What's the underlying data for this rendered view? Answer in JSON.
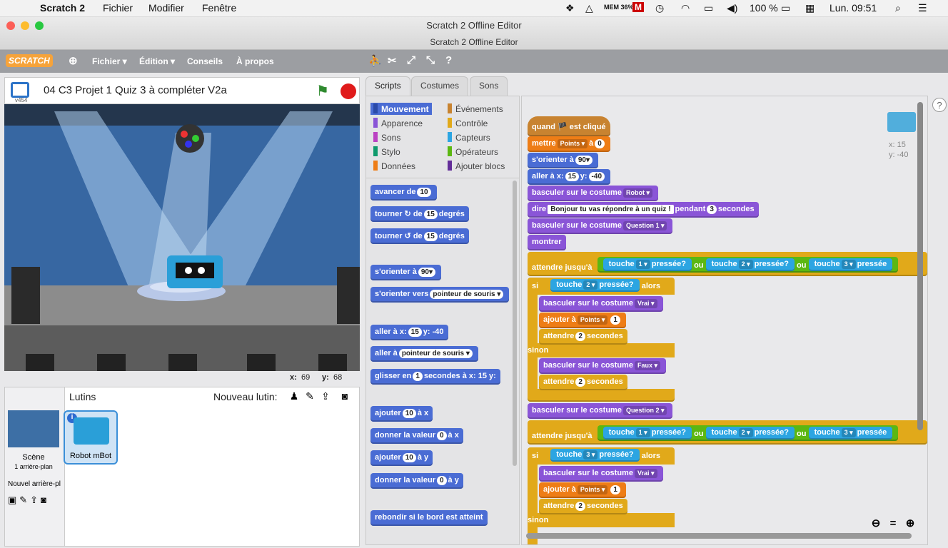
{
  "mac_menu": {
    "app": "Scratch 2",
    "items": [
      "Fichier",
      "Modifier",
      "Fenêtre"
    ],
    "mem": "MEM 36%",
    "battery": "100 %",
    "clock": "Lun. 09:51"
  },
  "window": {
    "title": "Scratch 2 Offline Editor",
    "subtitle": "Scratch 2 Offline Editor"
  },
  "scratch_menu": {
    "logo": "SCRATCH",
    "items": [
      "Fichier ▾",
      "Édition ▾",
      "Conseils",
      "À propos"
    ]
  },
  "stage": {
    "project_title": "04 C3 Projet 1 Quiz 3 à compléter V2a",
    "version": "v454",
    "mouse_x_label": "x:",
    "mouse_x": "69",
    "mouse_y_label": "y:",
    "mouse_y": "68"
  },
  "sprites_panel": {
    "title": "Lutins",
    "new_sprite": "Nouveau lutin:",
    "scene": "Scène",
    "scene_sub": "1 arrière-plan",
    "new_backdrop": "Nouvel arrière-pl",
    "sprite_name": "Robot mBot"
  },
  "tabs": [
    "Scripts",
    "Costumes",
    "Sons"
  ],
  "categories": [
    "Mouvement",
    "Apparence",
    "Sons",
    "Stylo",
    "Données",
    "Événements",
    "Contrôle",
    "Capteurs",
    "Opérateurs",
    "Ajouter blocs"
  ],
  "palette": [
    {
      "t": "avancer de",
      "v": "10"
    },
    {
      "t": "tourner ↻ de",
      "v": "15",
      "s": "degrés"
    },
    {
      "t": "tourner ↺ de",
      "v": "15",
      "s": "degrés"
    },
    {
      "t": "s'orienter à",
      "v": "90▾"
    },
    {
      "t": "s'orienter vers",
      "v": "pointeur de souris ▾"
    },
    {
      "t": "aller à x:",
      "v": "15",
      "s": "y: -40"
    },
    {
      "t": "aller à",
      "v": "pointeur de souris ▾"
    },
    {
      "t": "glisser en",
      "v": "1",
      "s": "secondes à x: 15 y:"
    },
    {
      "t": "ajouter",
      "v": "10",
      "s": "à x"
    },
    {
      "t": "donner la valeur",
      "v": "0",
      "s": "à x"
    },
    {
      "t": "ajouter",
      "v": "10",
      "s": "à y"
    },
    {
      "t": "donner la valeur",
      "v": "0",
      "s": "à y"
    },
    {
      "t": "rebondir si le bord est atteint",
      "v": "",
      "s": ""
    }
  ],
  "sprite_info": {
    "x": "x: 15",
    "y": "y: -40"
  },
  "script": {
    "hat": "quand 🏴 est cliqué",
    "b1": [
      "mettre",
      "Points ▾",
      "à",
      "0"
    ],
    "b2": [
      "s'orienter à",
      "90▾"
    ],
    "b3": [
      "aller à x:",
      "15",
      "y:",
      "-40"
    ],
    "b4": [
      "basculer sur le costume",
      "Robot ▾"
    ],
    "b5": [
      "dire",
      "Bonjour tu vas répondre à un quiz !",
      "pendant",
      "3",
      "secondes"
    ],
    "b6": [
      "basculer sur le costume",
      "Question 1 ▾"
    ],
    "b7": "montrer",
    "wait": [
      "attendre jusqu'à",
      "touche",
      "1 ▾",
      "pressée?",
      "ou",
      "touche",
      "2 ▾",
      "pressée?",
      "ou",
      "touche",
      "3 ▾",
      "pressée"
    ],
    "si": "si",
    "alors": "alors",
    "sinon": "sinon",
    "if1": [
      "touche",
      "2 ▾",
      "pressée?"
    ],
    "cost_vrai": [
      "basculer sur le costume",
      "Vrai ▾"
    ],
    "add_pts": [
      "ajouter à",
      "Points ▾",
      "1"
    ],
    "wait2": [
      "attendre",
      "2",
      "secondes"
    ],
    "cost_faux": [
      "basculer sur le costume",
      "Faux ▾"
    ],
    "q2": [
      "basculer sur le costume",
      "Question 2 ▾"
    ],
    "if2": [
      "touche",
      "3 ▾",
      "pressée?"
    ]
  }
}
